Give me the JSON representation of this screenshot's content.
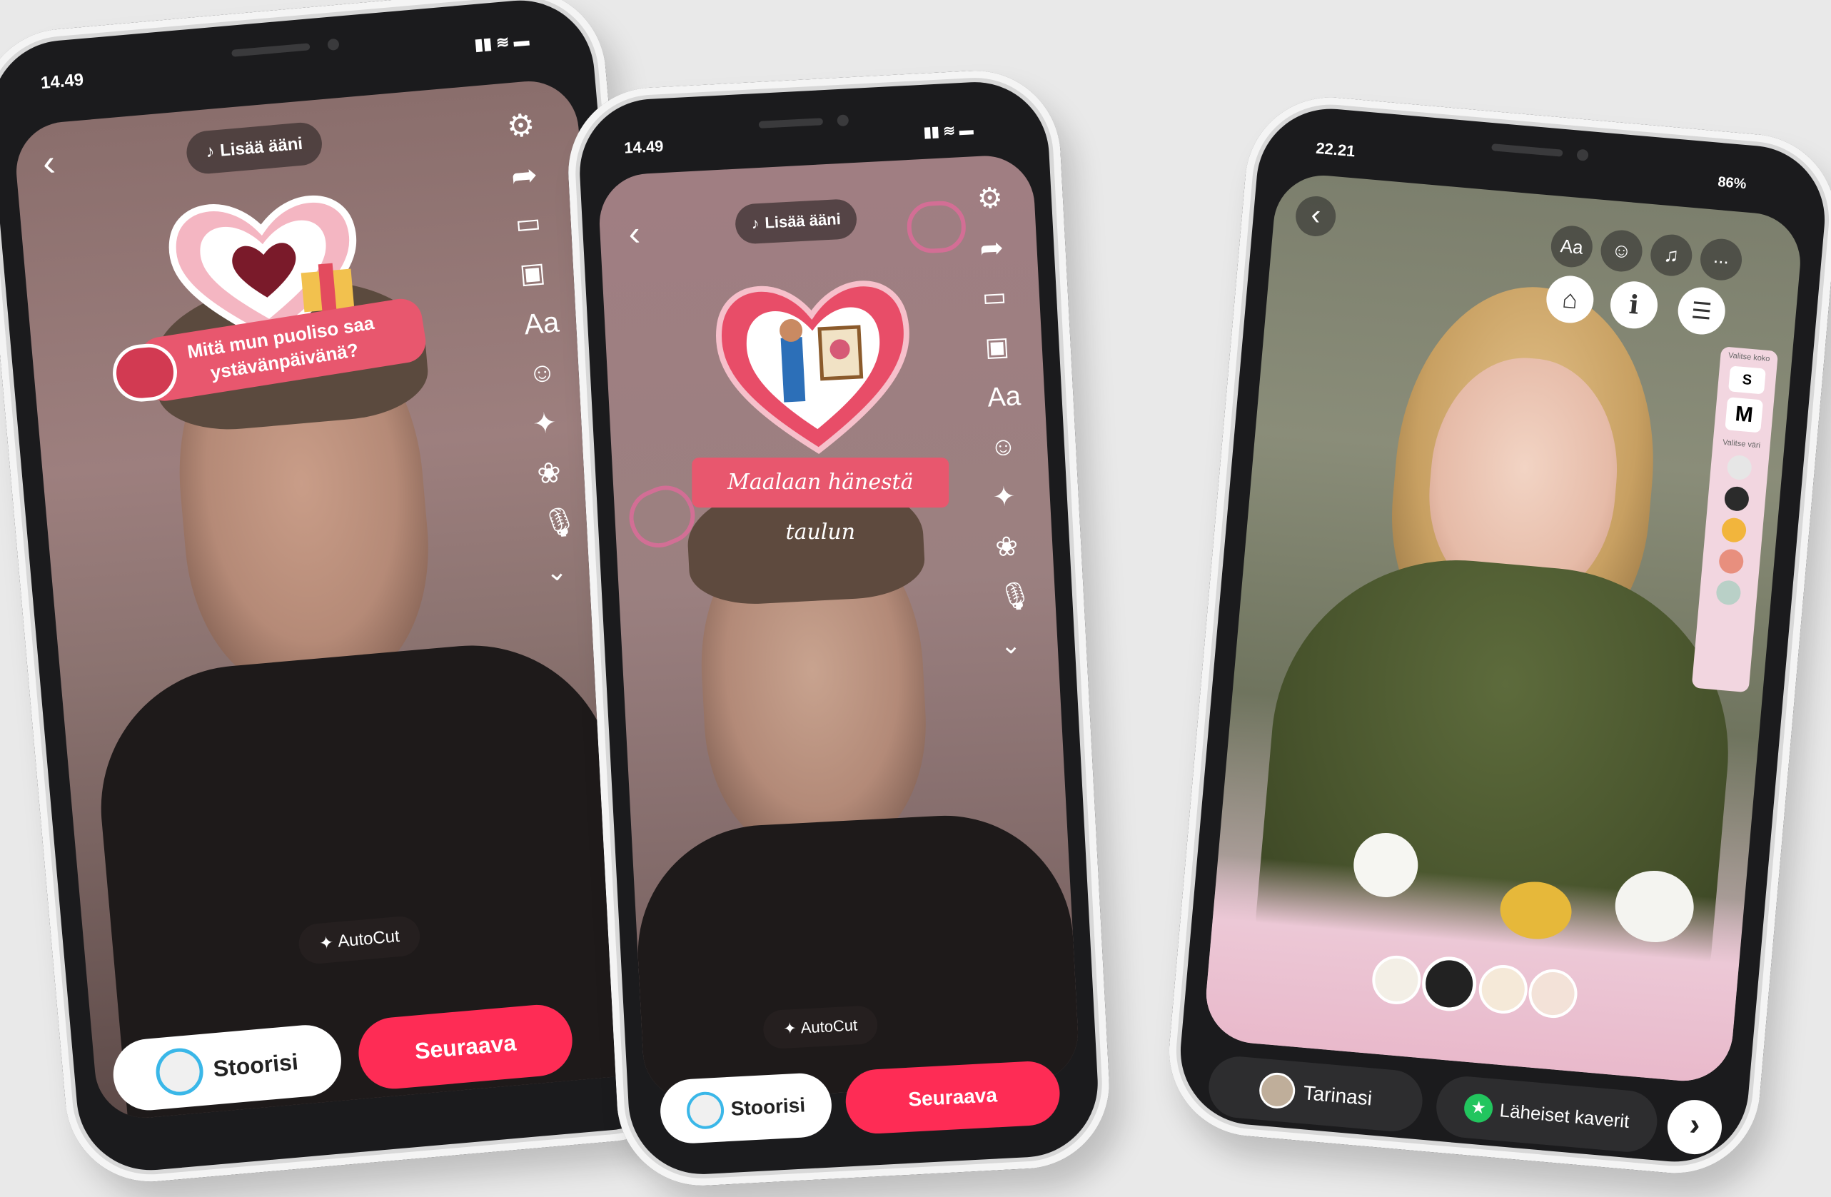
{
  "phones": [
    {
      "time": "14.49",
      "add_sound": "Lisää ääni",
      "icons": [
        "back-arrow-icon",
        "settings-icon",
        "share-icon",
        "template-icon",
        "photo-edit-icon",
        "text-icon",
        "sticker-icon",
        "effects-icon",
        "filters-icon",
        "voice-icon",
        "chevron-down-icon"
      ],
      "text_icon_label": "Aa",
      "sticker_text_line1": "Mitä mun puoliso saa",
      "sticker_text_line2": "ystävänpäivänä?",
      "autocut": "AutoCut",
      "story_button": "Stoorisi",
      "next_button": "Seuraava"
    },
    {
      "time": "14.49",
      "add_sound": "Lisää ääni",
      "text_icon_label": "Aa",
      "sticker_text": "Maalaan hänestä taulun",
      "autocut": "AutoCut",
      "story_button": "Stoorisi",
      "next_button": "Seuraava"
    },
    {
      "time": "22.21",
      "battery": "86%",
      "text_icon_label": "Aa",
      "more_label": "...",
      "info_label": "i",
      "size_panel_title": "Valitse koko",
      "size_small": "S",
      "size_medium": "M",
      "color_panel_title": "Valitse väri",
      "colors": [
        "#e6e6e6",
        "#2b2b2b",
        "#f2b53c",
        "#e88f7e",
        "#b9d0c7"
      ],
      "story_button": "Tarinasi",
      "close_friends_button": "Läheiset kaverit",
      "next_arrow": "›"
    }
  ],
  "colors": {
    "accent_red": "#fe2c55",
    "close_friends_green": "#22c55e"
  }
}
